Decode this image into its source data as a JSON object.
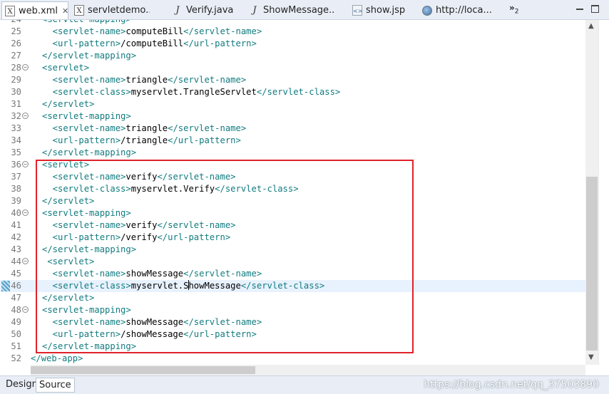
{
  "tabs": [
    {
      "label": "web.xml",
      "icon": "xml-file-icon",
      "active": true,
      "closable": true
    },
    {
      "label": "servletdemo...",
      "icon": "xml-file-icon",
      "active": false
    },
    {
      "label": "Verify.java",
      "icon": "java-file-icon",
      "active": false
    },
    {
      "label": "ShowMessage....",
      "icon": "java-file-icon",
      "active": false
    },
    {
      "label": "show.jsp",
      "icon": "jsp-file-icon",
      "active": false
    },
    {
      "label": "http://loca...",
      "icon": "globe-icon",
      "active": false
    }
  ],
  "tab_overflow": {
    "symbol": "»",
    "count": "2"
  },
  "lines": [
    {
      "n": "24",
      "fold": false,
      "parts": [
        {
          "t": "tag",
          "s": "<servlet-mapping>"
        }
      ]
    },
    {
      "n": "25",
      "fold": false,
      "parts": [
        {
          "t": "tag",
          "s": "  <servlet-name>"
        },
        {
          "t": "txt",
          "s": "computeBill"
        },
        {
          "t": "tag",
          "s": "</servlet-name>"
        }
      ]
    },
    {
      "n": "26",
      "fold": false,
      "parts": [
        {
          "t": "tag",
          "s": "  <url-pattern>"
        },
        {
          "t": "txt",
          "s": "/computeBill"
        },
        {
          "t": "tag",
          "s": "</url-pattern>"
        }
      ]
    },
    {
      "n": "27",
      "fold": false,
      "parts": [
        {
          "t": "tag",
          "s": "</servlet-mapping>"
        }
      ]
    },
    {
      "n": "28",
      "fold": true,
      "parts": [
        {
          "t": "tag",
          "s": "<servlet>"
        }
      ]
    },
    {
      "n": "29",
      "fold": false,
      "parts": [
        {
          "t": "tag",
          "s": "  <servlet-name>"
        },
        {
          "t": "txt",
          "s": "triangle"
        },
        {
          "t": "tag",
          "s": "</servlet-name>"
        }
      ]
    },
    {
      "n": "30",
      "fold": false,
      "parts": [
        {
          "t": "tag",
          "s": "  <servlet-class>"
        },
        {
          "t": "txt",
          "s": "myservlet.TrangleServlet"
        },
        {
          "t": "tag",
          "s": "</servlet-class>"
        }
      ]
    },
    {
      "n": "31",
      "fold": false,
      "parts": [
        {
          "t": "tag",
          "s": "</servlet>"
        }
      ]
    },
    {
      "n": "32",
      "fold": true,
      "parts": [
        {
          "t": "tag",
          "s": "<servlet-mapping>"
        }
      ]
    },
    {
      "n": "33",
      "fold": false,
      "parts": [
        {
          "t": "tag",
          "s": "  <servlet-name>"
        },
        {
          "t": "txt",
          "s": "triangle"
        },
        {
          "t": "tag",
          "s": "</servlet-name>"
        }
      ]
    },
    {
      "n": "34",
      "fold": false,
      "parts": [
        {
          "t": "tag",
          "s": "  <url-pattern>"
        },
        {
          "t": "txt",
          "s": "/triangle"
        },
        {
          "t": "tag",
          "s": "</url-pattern>"
        }
      ]
    },
    {
      "n": "35",
      "fold": false,
      "parts": [
        {
          "t": "tag",
          "s": "</servlet-mapping>"
        }
      ]
    },
    {
      "n": "36",
      "fold": true,
      "parts": [
        {
          "t": "tag",
          "s": "<servlet>"
        }
      ]
    },
    {
      "n": "37",
      "fold": false,
      "parts": [
        {
          "t": "tag",
          "s": "  <servlet-name>"
        },
        {
          "t": "txt",
          "s": "verify"
        },
        {
          "t": "tag",
          "s": "</servlet-name>"
        }
      ]
    },
    {
      "n": "38",
      "fold": false,
      "parts": [
        {
          "t": "tag",
          "s": "  <servlet-class>"
        },
        {
          "t": "txt",
          "s": "myservlet.Verify"
        },
        {
          "t": "tag",
          "s": "</servlet-class>"
        }
      ]
    },
    {
      "n": "39",
      "fold": false,
      "parts": [
        {
          "t": "tag",
          "s": "</servlet>"
        }
      ]
    },
    {
      "n": "40",
      "fold": true,
      "parts": [
        {
          "t": "tag",
          "s": "<servlet-mapping>"
        }
      ]
    },
    {
      "n": "41",
      "fold": false,
      "parts": [
        {
          "t": "tag",
          "s": "  <servlet-name>"
        },
        {
          "t": "txt",
          "s": "verify"
        },
        {
          "t": "tag",
          "s": "</servlet-name>"
        }
      ]
    },
    {
      "n": "42",
      "fold": false,
      "parts": [
        {
          "t": "tag",
          "s": "  <url-pattern>"
        },
        {
          "t": "txt",
          "s": "/verify"
        },
        {
          "t": "tag",
          "s": "</url-pattern>"
        }
      ]
    },
    {
      "n": "43",
      "fold": false,
      "parts": [
        {
          "t": "tag",
          "s": "</servlet-mapping>"
        }
      ]
    },
    {
      "n": "44",
      "fold": true,
      "parts": [
        {
          "t": "tag",
          "s": " <servlet>"
        }
      ]
    },
    {
      "n": "45",
      "fold": false,
      "parts": [
        {
          "t": "tag",
          "s": "  <servlet-name>"
        },
        {
          "t": "txt",
          "s": "showMessage"
        },
        {
          "t": "tag",
          "s": "</servlet-name>"
        }
      ]
    },
    {
      "n": "46",
      "fold": false,
      "current": true,
      "parts": [
        {
          "t": "tag",
          "s": "  <servlet-class>"
        },
        {
          "t": "txt",
          "s": "myservlet.S"
        },
        {
          "t": "caret",
          "s": ""
        },
        {
          "t": "txt",
          "s": "howMessage"
        },
        {
          "t": "tag",
          "s": "</servlet-class>"
        }
      ]
    },
    {
      "n": "47",
      "fold": false,
      "parts": [
        {
          "t": "tag",
          "s": "</servlet>"
        }
      ]
    },
    {
      "n": "48",
      "fold": true,
      "parts": [
        {
          "t": "tag",
          "s": "<servlet-mapping>"
        }
      ]
    },
    {
      "n": "49",
      "fold": false,
      "parts": [
        {
          "t": "tag",
          "s": "  <servlet-name>"
        },
        {
          "t": "txt",
          "s": "showMessage"
        },
        {
          "t": "tag",
          "s": "</servlet-name>"
        }
      ]
    },
    {
      "n": "50",
      "fold": false,
      "parts": [
        {
          "t": "tag",
          "s": "  <url-pattern>"
        },
        {
          "t": "txt",
          "s": "/showMessage"
        },
        {
          "t": "tag",
          "s": "</url-pattern>"
        }
      ]
    },
    {
      "n": "51",
      "fold": false,
      "parts": [
        {
          "t": "tag",
          "s": "</servlet-mapping>"
        }
      ]
    },
    {
      "n": "52",
      "fold": false,
      "root": true,
      "parts": [
        {
          "t": "tag",
          "s": "</web-app>"
        }
      ]
    }
  ],
  "bottom_tabs": [
    {
      "label": "Design",
      "active": false
    },
    {
      "label": "Source",
      "active": true
    }
  ],
  "watermark": "https://blog.csdn.net/qq_37503890",
  "colors": {
    "tag": "#117b7f",
    "text": "#000000",
    "highlight_box": "#e0222b",
    "current_line": "#e8f2fe"
  }
}
